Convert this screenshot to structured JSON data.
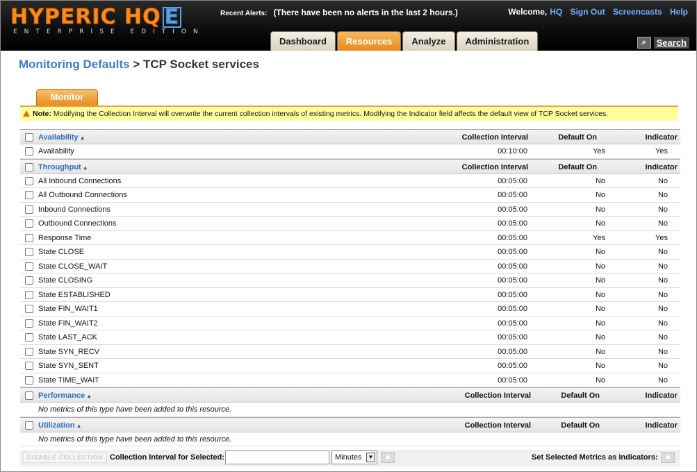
{
  "header": {
    "logo_main": "HYPERIC HQ",
    "logo_e": "E",
    "logo_sub": "ENTERPRISE EDITION",
    "alerts_label": "Recent Alerts:",
    "alerts_text": "(There have been no alerts in the last 2 hours.)",
    "welcome": "Welcome,",
    "user": "HQ",
    "sign_out": "Sign Out",
    "screencasts": "Screencasts",
    "help": "Help",
    "tabs": [
      {
        "label": "Dashboard"
      },
      {
        "label": "Resources"
      },
      {
        "label": "Analyze"
      },
      {
        "label": "Administration"
      }
    ],
    "search_label": "Search"
  },
  "title": {
    "crumb": "Monitoring Defaults",
    "sep": ">",
    "current": "TCP Socket services"
  },
  "monitor_tab": "Monitor",
  "note": {
    "bold": "Note:",
    "text": "Modifying the Collection Interval will overwrite the current collection intervals of existing metrics. Modifying the Indicator field affects the default view of TCP Socket services."
  },
  "columns": {
    "interval": "Collection Interval",
    "default_on": "Default On",
    "indicator": "Indicator"
  },
  "sections": {
    "availability": {
      "name": "Availability",
      "rows": [
        {
          "name": "Availability",
          "interval": "00:10:00",
          "default_on": "Yes",
          "indicator": "Yes"
        }
      ]
    },
    "throughput": {
      "name": "Throughput",
      "rows": [
        {
          "name": "All Inbound Connections",
          "interval": "00:05:00",
          "default_on": "No",
          "indicator": "No"
        },
        {
          "name": "All Outbound Connections",
          "interval": "00:05:00",
          "default_on": "No",
          "indicator": "No"
        },
        {
          "name": "Inbound Connections",
          "interval": "00:05:00",
          "default_on": "No",
          "indicator": "No"
        },
        {
          "name": "Outbound Connections",
          "interval": "00:05:00",
          "default_on": "No",
          "indicator": "No"
        },
        {
          "name": "Response Time",
          "interval": "00:05:00",
          "default_on": "Yes",
          "indicator": "Yes"
        },
        {
          "name": "State CLOSE",
          "interval": "00:05:00",
          "default_on": "No",
          "indicator": "No"
        },
        {
          "name": "State CLOSE_WAIT",
          "interval": "00:05:00",
          "default_on": "No",
          "indicator": "No"
        },
        {
          "name": "State CLOSING",
          "interval": "00:05:00",
          "default_on": "No",
          "indicator": "No"
        },
        {
          "name": "State ESTABLISHED",
          "interval": "00:05:00",
          "default_on": "No",
          "indicator": "No"
        },
        {
          "name": "State FIN_WAIT1",
          "interval": "00:05:00",
          "default_on": "No",
          "indicator": "No"
        },
        {
          "name": "State FIN_WAIT2",
          "interval": "00:05:00",
          "default_on": "No",
          "indicator": "No"
        },
        {
          "name": "State LAST_ACK",
          "interval": "00:05:00",
          "default_on": "No",
          "indicator": "No"
        },
        {
          "name": "State SYN_RECV",
          "interval": "00:05:00",
          "default_on": "No",
          "indicator": "No"
        },
        {
          "name": "State SYN_SENT",
          "interval": "00:05:00",
          "default_on": "No",
          "indicator": "No"
        },
        {
          "name": "State TIME_WAIT",
          "interval": "00:05:00",
          "default_on": "No",
          "indicator": "No"
        }
      ]
    },
    "performance": {
      "name": "Performance",
      "empty_msg": "No metrics of this type have been added to this resource."
    },
    "utilization": {
      "name": "Utilization",
      "empty_msg": "No metrics of this type have been added to this resource."
    }
  },
  "bottom": {
    "disable_label": "DISABLE COLLECTION",
    "interval_label": "Collection Interval for Selected:",
    "interval_value": "",
    "unit": "Minutes",
    "indicators_label": "Set Selected Metrics as Indicators:"
  }
}
